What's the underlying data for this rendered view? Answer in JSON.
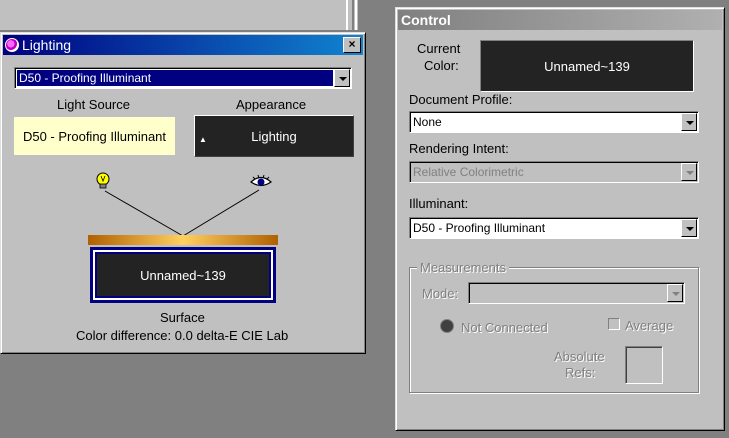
{
  "lighting_window": {
    "title": "Lighting",
    "close_label": "×",
    "illuminant_selected": "D50 - Proofing Illuminant",
    "light_source_label": "Light Source",
    "light_source_value": "D50 - Proofing Illuminant",
    "appearance_label": "Appearance",
    "appearance_value": "Lighting",
    "surface_swatch": "Unnamed~139",
    "surface_label": "Surface",
    "color_difference": "Color difference: 0.0 delta-E CIE Lab",
    "icons": {
      "light": "lightbulb-icon",
      "viewer": "eye-icon"
    }
  },
  "control_window": {
    "title": "Control",
    "current_color_label_1": "Current",
    "current_color_label_2": "Color:",
    "current_color_value": "Unnamed~139",
    "document_profile_label": "Document Profile:",
    "document_profile_value": "None",
    "rendering_intent_label": "Rendering Intent:",
    "rendering_intent_value": "Relative Colorimetric",
    "illuminant_label": "Illuminant:",
    "illuminant_value": "D50 - Proofing Illuminant",
    "measurements": {
      "group_label": "Measurements",
      "mode_label": "Mode:",
      "mode_value": "",
      "connection_status": "Not Connected",
      "average_label": "Average",
      "absolute_refs_label_1": "Absolute",
      "absolute_refs_label_2": "Refs:"
    }
  },
  "colors": {
    "title_active": "#000080",
    "swatch": "#232323",
    "light_source_bg": "#ffffcc",
    "desktop": "#808080"
  }
}
